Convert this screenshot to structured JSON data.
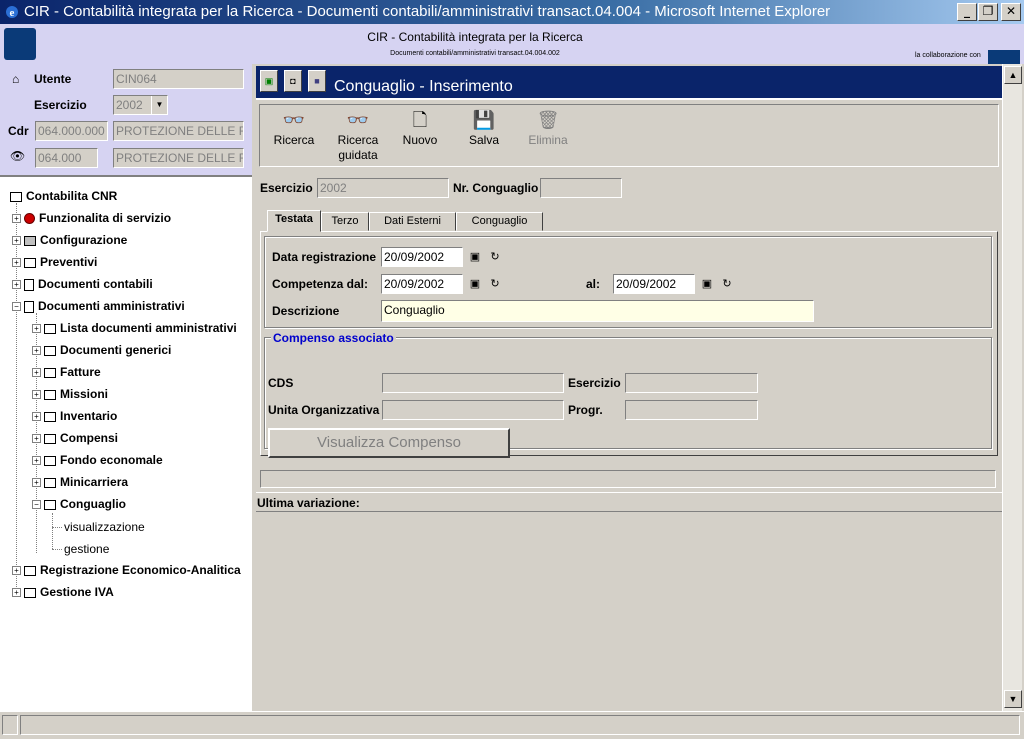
{
  "window": {
    "title": "CIR - Contabilità integrata per la Ricerca - Documenti contabili/amministrativi transact.04.004 - Microsoft Internet Explorer",
    "min": "_",
    "max": "❐",
    "close": "✕"
  },
  "banner": {
    "title": "CIR - Contabilità integrata per la Ricerca",
    "subtitle": "Documenti contabili/amministrativi transact.04.004.002",
    "collab": "la collaborazione con",
    "partner_logo": "CINECA"
  },
  "user": {
    "utente_label": "Utente",
    "utente_value": "CIN064",
    "esercizio_label": "Esercizio",
    "esercizio_value": "2002",
    "cdr_label": "Cdr",
    "cdr_code": "064.000.000",
    "cdr_desc": "PROTEZIONE DELLE F",
    "uo_code": "064.000",
    "uo_desc": "PROTEZIONE DELLE F"
  },
  "tree": {
    "root": "Contabilita CNR",
    "items": [
      "Funzionalita di servizio",
      "Configurazione",
      "Preventivi",
      "Documenti contabili",
      "Documenti amministrativi",
      "Lista documenti amministrativi",
      "Documenti generici",
      "Fatture",
      "Missioni",
      "Inventario",
      "Compensi",
      "Fondo economale",
      "Minicarriera",
      "Conguaglio",
      "visualizzazione",
      "gestione",
      "Registrazione Economico-Analitica",
      "Gestione IVA"
    ]
  },
  "page": {
    "title": "Conguaglio - Inserimento"
  },
  "toolbar": {
    "ricerca": "Ricerca",
    "ricerca_guidata_1": "Ricerca",
    "ricerca_guidata_2": "guidata",
    "nuovo": "Nuovo",
    "salva": "Salva",
    "elimina": "Elimina"
  },
  "form": {
    "esercizio_label": "Esercizio",
    "esercizio_value": "2002",
    "nr_label": "Nr. Conguaglio",
    "nr_value": ""
  },
  "tabs": [
    "Testata",
    "Terzo",
    "Dati Esterni",
    "Conguaglio"
  ],
  "testata": {
    "data_reg_label": "Data registrazione",
    "data_reg_value": "20/09/2002",
    "comp_dal_label": "Competenza dal:",
    "comp_dal_value": "20/09/2002",
    "al_label": "al:",
    "al_value": "20/09/2002",
    "descr_label": "Descrizione",
    "descr_value": "Conguaglio"
  },
  "compenso": {
    "legend": "Compenso associato",
    "cds_label": "CDS",
    "esercizio_label": "Esercizio",
    "uo_label": "Unita Organizzativa",
    "progr_label": "Progr.",
    "button": "Visualizza Compenso"
  },
  "footer": {
    "ultima": "Ultima variazione:"
  }
}
